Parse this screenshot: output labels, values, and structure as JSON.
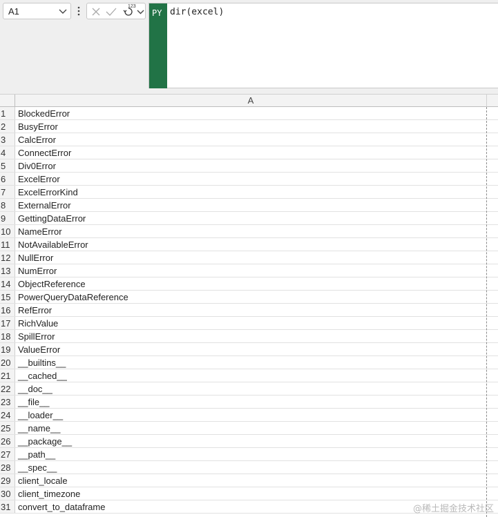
{
  "name_box": {
    "value": "A1"
  },
  "formula_bar": {
    "badge": "PY",
    "formula": "dir(excel)",
    "output_type_superscript": "123"
  },
  "column_header": {
    "label": "A"
  },
  "rows": [
    {
      "num": "1",
      "value": "BlockedError"
    },
    {
      "num": "2",
      "value": "BusyError"
    },
    {
      "num": "3",
      "value": "CalcError"
    },
    {
      "num": "4",
      "value": "ConnectError"
    },
    {
      "num": "5",
      "value": "Div0Error"
    },
    {
      "num": "6",
      "value": "ExcelError"
    },
    {
      "num": "7",
      "value": "ExcelErrorKind"
    },
    {
      "num": "8",
      "value": "ExternalError"
    },
    {
      "num": "9",
      "value": "GettingDataError"
    },
    {
      "num": "10",
      "value": "NameError"
    },
    {
      "num": "11",
      "value": "NotAvailableError"
    },
    {
      "num": "12",
      "value": "NullError"
    },
    {
      "num": "13",
      "value": "NumError"
    },
    {
      "num": "14",
      "value": "ObjectReference"
    },
    {
      "num": "15",
      "value": "PowerQueryDataReference"
    },
    {
      "num": "16",
      "value": "RefError"
    },
    {
      "num": "17",
      "value": "RichValue"
    },
    {
      "num": "18",
      "value": "SpillError"
    },
    {
      "num": "19",
      "value": "ValueError"
    },
    {
      "num": "20",
      "value": "__builtins__"
    },
    {
      "num": "21",
      "value": "__cached__"
    },
    {
      "num": "22",
      "value": "__doc__"
    },
    {
      "num": "23",
      "value": "__file__"
    },
    {
      "num": "24",
      "value": "__loader__"
    },
    {
      "num": "25",
      "value": "__name__"
    },
    {
      "num": "26",
      "value": "__package__"
    },
    {
      "num": "27",
      "value": "__path__"
    },
    {
      "num": "28",
      "value": "__spec__"
    },
    {
      "num": "29",
      "value": "client_locale"
    },
    {
      "num": "30",
      "value": "client_timezone"
    },
    {
      "num": "31",
      "value": "convert_to_dataframe"
    }
  ],
  "watermark": "@稀土掘金技术社区",
  "colors": {
    "python_badge": "#217346"
  }
}
